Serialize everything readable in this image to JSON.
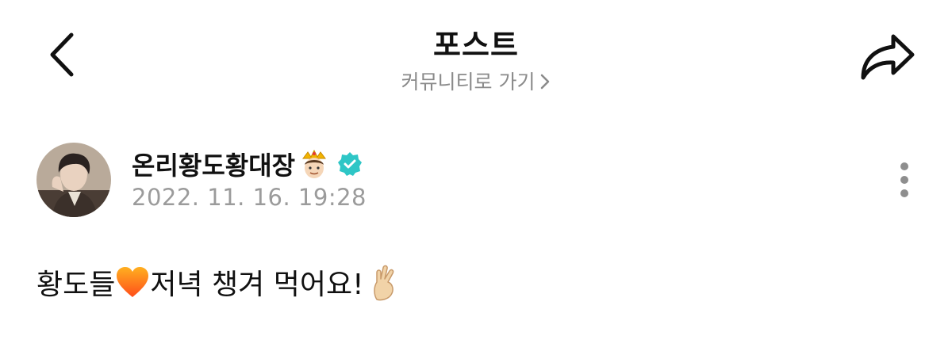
{
  "header": {
    "title": "포스트",
    "community_link_label": "커뮤니티로 가기",
    "back_icon": "chevron-left-icon",
    "share_icon": "share-icon",
    "community_chevron_icon": "chevron-right-icon"
  },
  "author": {
    "name": "온리황도황대장",
    "name_emoji": "prince-emoji",
    "verified_icon": "verified-badge-icon",
    "verified_color": "#2ec6c6",
    "timestamp": "2022. 11. 16. 19:28",
    "more_icon": "more-vertical-icon"
  },
  "post": {
    "text_part1": "황도들",
    "emoji_heart": "orange-heart-emoji",
    "text_part2": "저녁 챙겨 먹어요!",
    "emoji_hand": "crossed-fingers-emoji"
  }
}
